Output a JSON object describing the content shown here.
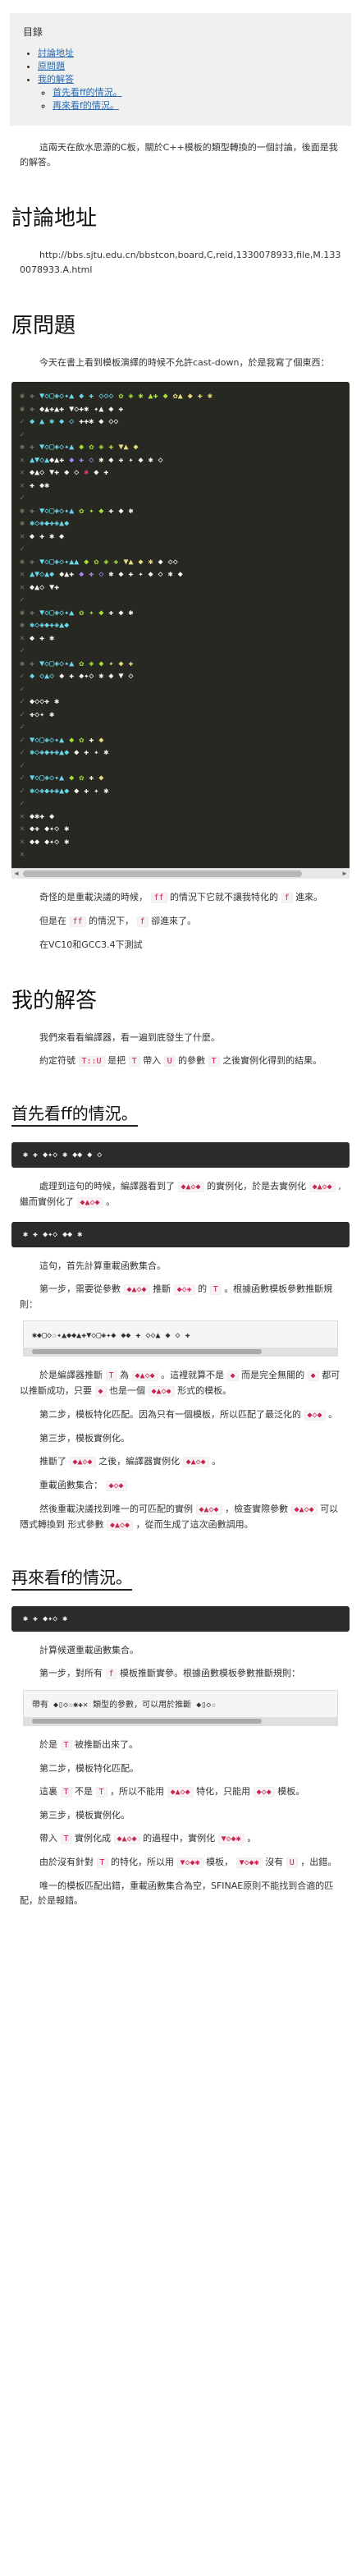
{
  "toc": {
    "title": "目錄",
    "items": [
      {
        "label": "討論地址"
      },
      {
        "label": "原問題"
      },
      {
        "label": "我的解答"
      }
    ],
    "sub_items": [
      {
        "label": "首先看ff的情況。"
      },
      {
        "label": "再來看f的情況。"
      }
    ]
  },
  "intro": {
    "text": "這兩天在飲水思源的C板，關於C++模板的類型轉換的一個討論，後面是我的解答。"
  },
  "sec_discussion": {
    "heading": "討論地址",
    "url": "http://bbs.sjtu.edu.cn/bbstcon,board,C,reid,1330078933,file,M.1330078933.A.html"
  },
  "sec_problem": {
    "heading": "原問題",
    "p1": "今天在書上看到模板演繹的時候不允許cast-down，於是我寫了個東西：",
    "p2_a": "奇怪的是重載決議的時候，",
    "p2_b": "的情況下它就不讓我特化的",
    "p2_c": "進來。",
    "p3_a": "但是在",
    "p3_b": "的情況下，",
    "p3_c": "卻進來了。",
    "p4": "在VC10和GCC3.4下測試"
  },
  "sec_answer": {
    "heading": "我的解答",
    "p1": "我們來看看編譯器，看一遍到底發生了什麼。",
    "p2_a": "約定符號",
    "p2_b": "是把",
    "p2_c": "帶入",
    "p2_d": "的參數",
    "p2_e": "之後實例化得到的結果。"
  },
  "sec_ff": {
    "heading": "首先看ff的情況。",
    "p1_a": "處理到這句的時候，編譯器看到了",
    "p1_b": "的實例化，於是去實例化",
    "p1_c": ",繼而實例化了",
    "p1_d": "。",
    "p2": "這句，首先計算重載函數集合。",
    "p3_a": "第一步，需要從參數",
    "p3_b": "推斷",
    "p3_c": "的",
    "p3_d": "。根據函數模板參數推斷規則：",
    "p4_a": "於是編譯器推斷",
    "p4_b": "為",
    "p4_c": "。這裡就算不是",
    "p4_d": "而是完全無關的",
    "p4_e": "都可以推斷成功，只要",
    "p4_f": "也是一個",
    "p4_g": "形式的模板。",
    "p5_a": "第二步，模板特化匹配。因為只有一個模板，所以匹配了最泛化的",
    "p5_b": "。",
    "p6": "第三步，模板實例化。",
    "p7_a": "推斷了",
    "p7_b": "之後，編譯器實例化",
    "p7_c": "。",
    "p8_a": "重載函數集合：",
    "p9_a": "然後重載決議找到唯一的可匹配的實例",
    "p9_b": "，檢查實際參數",
    "p9_c": "可以隱式轉換到 形式參數",
    "p9_d": "，從而生成了這次函數調用。"
  },
  "sec_f": {
    "heading": "再來看f的情況。",
    "p1": "計算候選重載函數集合。",
    "p2_a": "第一步，對所有",
    "p2_b": "模板推斷實參。根據函數模板參數推斷規則：",
    "code": "帶有 ◆▯◇☆✱✚✕ 類型的參數，可以用於推斷 ◆▯◇☆",
    "p3_a": "於是",
    "p3_b": "被推斷出來了。",
    "p4": "第二步，模板特化匹配。",
    "p5_a": "這裏",
    "p5_b": "不是",
    "p5_c": "，所以不能用",
    "p5_d": "特化，只能用",
    "p5_e": "模板。",
    "p6": "第三步，模板實例化。",
    "p7_a": "帶入",
    "p7_b": "實例化成",
    "p7_c": "的過程中，實例化",
    "p7_d": "。",
    "p8_a": "由於沒有針對",
    "p8_b": "的特化，所以用",
    "p8_c": "模板，",
    "p8_d": "沒有",
    "p8_e": "，出錯。",
    "p9": "唯一的模板匹配出錯，重載函數集合為空，SFINAE原則不能找到合適的匹配，於是報錯。"
  },
  "colors": {
    "term_bg": "#272822",
    "link": "#2a6ab0",
    "inline_code": "#c7254e"
  }
}
